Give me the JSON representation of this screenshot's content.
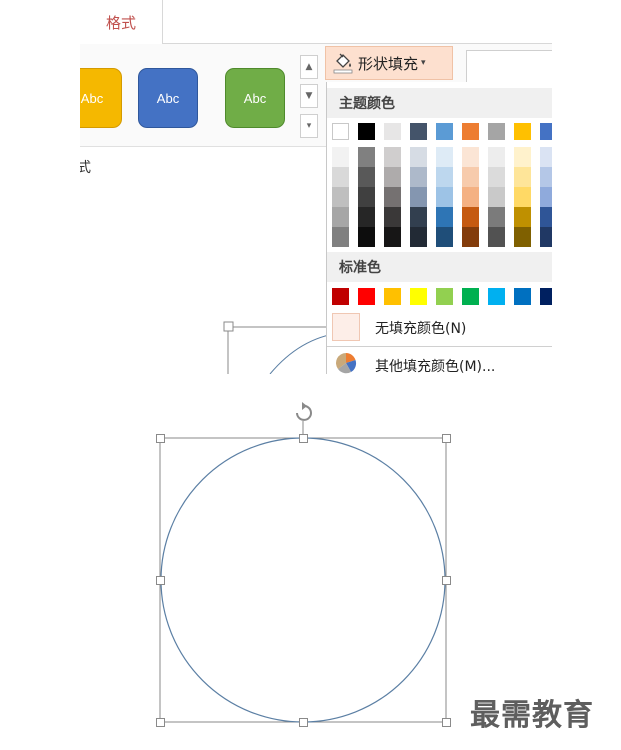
{
  "ribbon": {
    "active_tab": "格式",
    "style_buttons": [
      {
        "label": "Abc",
        "color": "#f5b800"
      },
      {
        "label": "Abc",
        "color": "#4472c4"
      },
      {
        "label": "Abc",
        "color": "#70ad47"
      }
    ],
    "group_label": "式",
    "scroll_up": "▲",
    "scroll_down": "▼",
    "scroll_more": "▾"
  },
  "shape_fill": {
    "label": "形状填充",
    "arrow": "▾",
    "icon": "paint-bucket-icon"
  },
  "dropdown": {
    "theme_colors_header": "主题颜色",
    "theme_colors": [
      "#ffffff",
      "#000000",
      "#e7e6e6",
      "#44546a",
      "#5b9bd5",
      "#ed7d31",
      "#a5a5a5",
      "#ffc000",
      "#4472c4"
    ],
    "theme_shades": [
      [
        "#f2f2f2",
        "#d9d9d9",
        "#bfbfbf",
        "#a6a6a6",
        "#808080"
      ],
      [
        "#808080",
        "#595959",
        "#404040",
        "#262626",
        "#0d0d0d"
      ],
      [
        "#d0cece",
        "#aeabab",
        "#757171",
        "#3a3838",
        "#171616"
      ],
      [
        "#d6dce4",
        "#adb9ca",
        "#8496b0",
        "#323f4f",
        "#222a35"
      ],
      [
        "#deebf6",
        "#bdd7ee",
        "#9dc3e6",
        "#2e75b5",
        "#1f4e79"
      ],
      [
        "#fbe5d5",
        "#f7cbac",
        "#f4b183",
        "#c55a11",
        "#833c0b"
      ],
      [
        "#ededed",
        "#dbdbdb",
        "#c9c9c9",
        "#7b7b7b",
        "#525252"
      ],
      [
        "#fff2cc",
        "#fee599",
        "#ffd965",
        "#bf9000",
        "#7f6000"
      ],
      [
        "#dae3f3",
        "#b4c7e7",
        "#8faadc",
        "#2f5597",
        "#203864"
      ]
    ],
    "standard_colors_header": "标准色",
    "standard_colors": [
      "#c00000",
      "#ff0000",
      "#ffc000",
      "#ffff00",
      "#92d050",
      "#00b050",
      "#00b0f0",
      "#0070c0",
      "#002060"
    ],
    "no_fill_label": "无填充颜色(N)",
    "more_colors_label": "其他填充颜色(M)...",
    "more_colors_icon": "color-palette-icon"
  },
  "canvas": {
    "shape": "circle",
    "outline_color": "#5b7fa4",
    "rotate_icon": "rotate-handle-icon"
  },
  "watermark": "最需教育"
}
